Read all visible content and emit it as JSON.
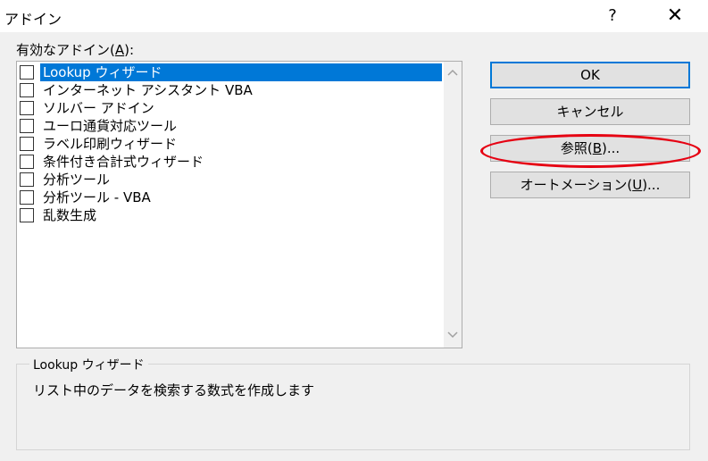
{
  "window": {
    "title": "アドイン",
    "help_symbol": "?",
    "close_symbol": "✕"
  },
  "addins": {
    "label": "有効なアドイン(A):",
    "label_pre": "有効なアドイン(",
    "label_key": "A",
    "label_post": "):",
    "items": [
      {
        "label": "Lookup ウィザード",
        "checked": false,
        "selected": true
      },
      {
        "label": "インターネット アシスタント VBA",
        "checked": false,
        "selected": false
      },
      {
        "label": "ソルバー アドイン",
        "checked": false,
        "selected": false
      },
      {
        "label": "ユーロ通貨対応ツール",
        "checked": false,
        "selected": false
      },
      {
        "label": "ラベル印刷ウィザード",
        "checked": false,
        "selected": false
      },
      {
        "label": "条件付き合計式ウィザード",
        "checked": false,
        "selected": false
      },
      {
        "label": "分析ツール",
        "checked": false,
        "selected": false
      },
      {
        "label": "分析ツール - VBA",
        "checked": false,
        "selected": false
      },
      {
        "label": "乱数生成",
        "checked": false,
        "selected": false
      }
    ]
  },
  "buttons": {
    "ok": "OK",
    "cancel": "キャンセル",
    "browse_pre": "参照(",
    "browse_key": "B",
    "browse_post": ")...",
    "automation_pre": "オートメーション(",
    "automation_key": "U",
    "automation_post": ")..."
  },
  "description": {
    "title": "Lookup ウィザード",
    "text": "リスト中のデータを検索する数式を作成します"
  },
  "colors": {
    "selection": "#0078d7",
    "highlight_ellipse": "#e60012"
  },
  "icons": {
    "scroll_up": "chevron-up-icon",
    "scroll_down": "chevron-down-icon"
  }
}
